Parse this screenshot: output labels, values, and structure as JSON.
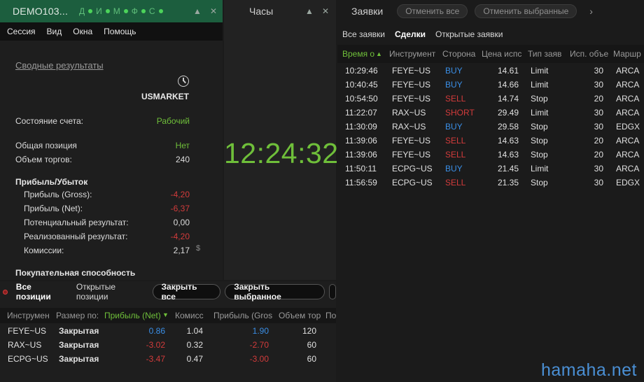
{
  "account": {
    "title": "DEMO103...",
    "indicator_letters": [
      "Д",
      "И",
      "М",
      "Ф",
      "С"
    ],
    "menu": [
      "Сессия",
      "Вид",
      "Окна",
      "Помощь"
    ],
    "summary_link": "Сводные результаты",
    "market": "USMARKET",
    "rows": {
      "state_label": "Состояние счета:",
      "state_value": "Рабочий",
      "position_label": "Общая позиция",
      "position_value": "Нет",
      "volume_label": "Объем торгов:",
      "volume_value": "240",
      "pl_header": "Прибыль/Убыток",
      "gross_label": "Прибыль (Gross):",
      "gross_value": "-4,20",
      "net_label": "Прибыль (Net):",
      "net_value": "-6,37",
      "potential_label": "Потенциальный результат:",
      "potential_value": "0,00",
      "realized_label": "Реализованный результат:",
      "realized_value": "-4,20",
      "commission_label": "Комиссии:",
      "commission_value": "2,17",
      "commission_currency": "$",
      "buying_power_header": "Покупательная способность"
    }
  },
  "clock": {
    "title": "Часы",
    "time": "12:24:32"
  },
  "orders": {
    "title": "Заявки",
    "cancel_all": "Отменить все",
    "cancel_selected": "Отменить выбранные",
    "tabs": [
      "Все заявки",
      "Сделки",
      "Открытые заявки"
    ],
    "active_tab": "Сделки",
    "columns": [
      "Время о",
      "Инструмент",
      "Сторона",
      "Цена испс",
      "Тип заяв",
      "Исп. объе",
      "Маршр"
    ],
    "rows": [
      {
        "time": "10:29:46",
        "instrument": "FEYE~US",
        "side": "BUY",
        "price": "14.61",
        "type": "Limit",
        "qty": "30",
        "route": "ARCA"
      },
      {
        "time": "10:40:45",
        "instrument": "FEYE~US",
        "side": "BUY",
        "price": "14.66",
        "type": "Limit",
        "qty": "30",
        "route": "ARCA"
      },
      {
        "time": "10:54:50",
        "instrument": "FEYE~US",
        "side": "SELL",
        "price": "14.74",
        "type": "Stop",
        "qty": "20",
        "route": "ARCA"
      },
      {
        "time": "11:22:07",
        "instrument": "RAX~US",
        "side": "SHORT",
        "price": "29.49",
        "type": "Limit",
        "qty": "30",
        "route": "ARCA"
      },
      {
        "time": "11:30:09",
        "instrument": "RAX~US",
        "side": "BUY",
        "price": "29.58",
        "type": "Stop",
        "qty": "30",
        "route": "EDGX"
      },
      {
        "time": "11:39:06",
        "instrument": "FEYE~US",
        "side": "SELL",
        "price": "14.63",
        "type": "Stop",
        "qty": "20",
        "route": "ARCA"
      },
      {
        "time": "11:39:06",
        "instrument": "FEYE~US",
        "side": "SELL",
        "price": "14.63",
        "type": "Stop",
        "qty": "20",
        "route": "ARCA"
      },
      {
        "time": "11:50:11",
        "instrument": "ECPG~US",
        "side": "BUY",
        "price": "21.45",
        "type": "Limit",
        "qty": "30",
        "route": "ARCA"
      },
      {
        "time": "11:56:59",
        "instrument": "ECPG~US",
        "side": "SELL",
        "price": "21.35",
        "type": "Stop",
        "qty": "30",
        "route": "EDGX"
      }
    ]
  },
  "positions": {
    "tabs": [
      "Все позиции",
      "Открытые позиции"
    ],
    "close_all": "Закрыть все",
    "close_selected": "Закрыть выбранное",
    "columns": [
      "Инструмен",
      "Размер по:",
      "Прибыль (Net)",
      "Комисс",
      "Прибыль (Gros",
      "Объем тор",
      "По"
    ],
    "rows": [
      {
        "instrument": "FEYE~US",
        "size": "Закрытая",
        "net": "0.86",
        "commission": "1.04",
        "gross": "1.90",
        "volume": "120"
      },
      {
        "instrument": "RAX~US",
        "size": "Закрытая",
        "net": "-3.02",
        "commission": "0.32",
        "gross": "-2.70",
        "volume": "60"
      },
      {
        "instrument": "ECPG~US",
        "size": "Закрытая",
        "net": "-3.47",
        "commission": "0.47",
        "gross": "-3.00",
        "volume": "60"
      }
    ]
  },
  "watermark": "hamaha.net",
  "colors": {
    "accent_green": "#6fbf3a",
    "negative_red": "#d23b3b",
    "positive_blue": "#3a8ee6",
    "title_green": "#1c5e3e"
  }
}
